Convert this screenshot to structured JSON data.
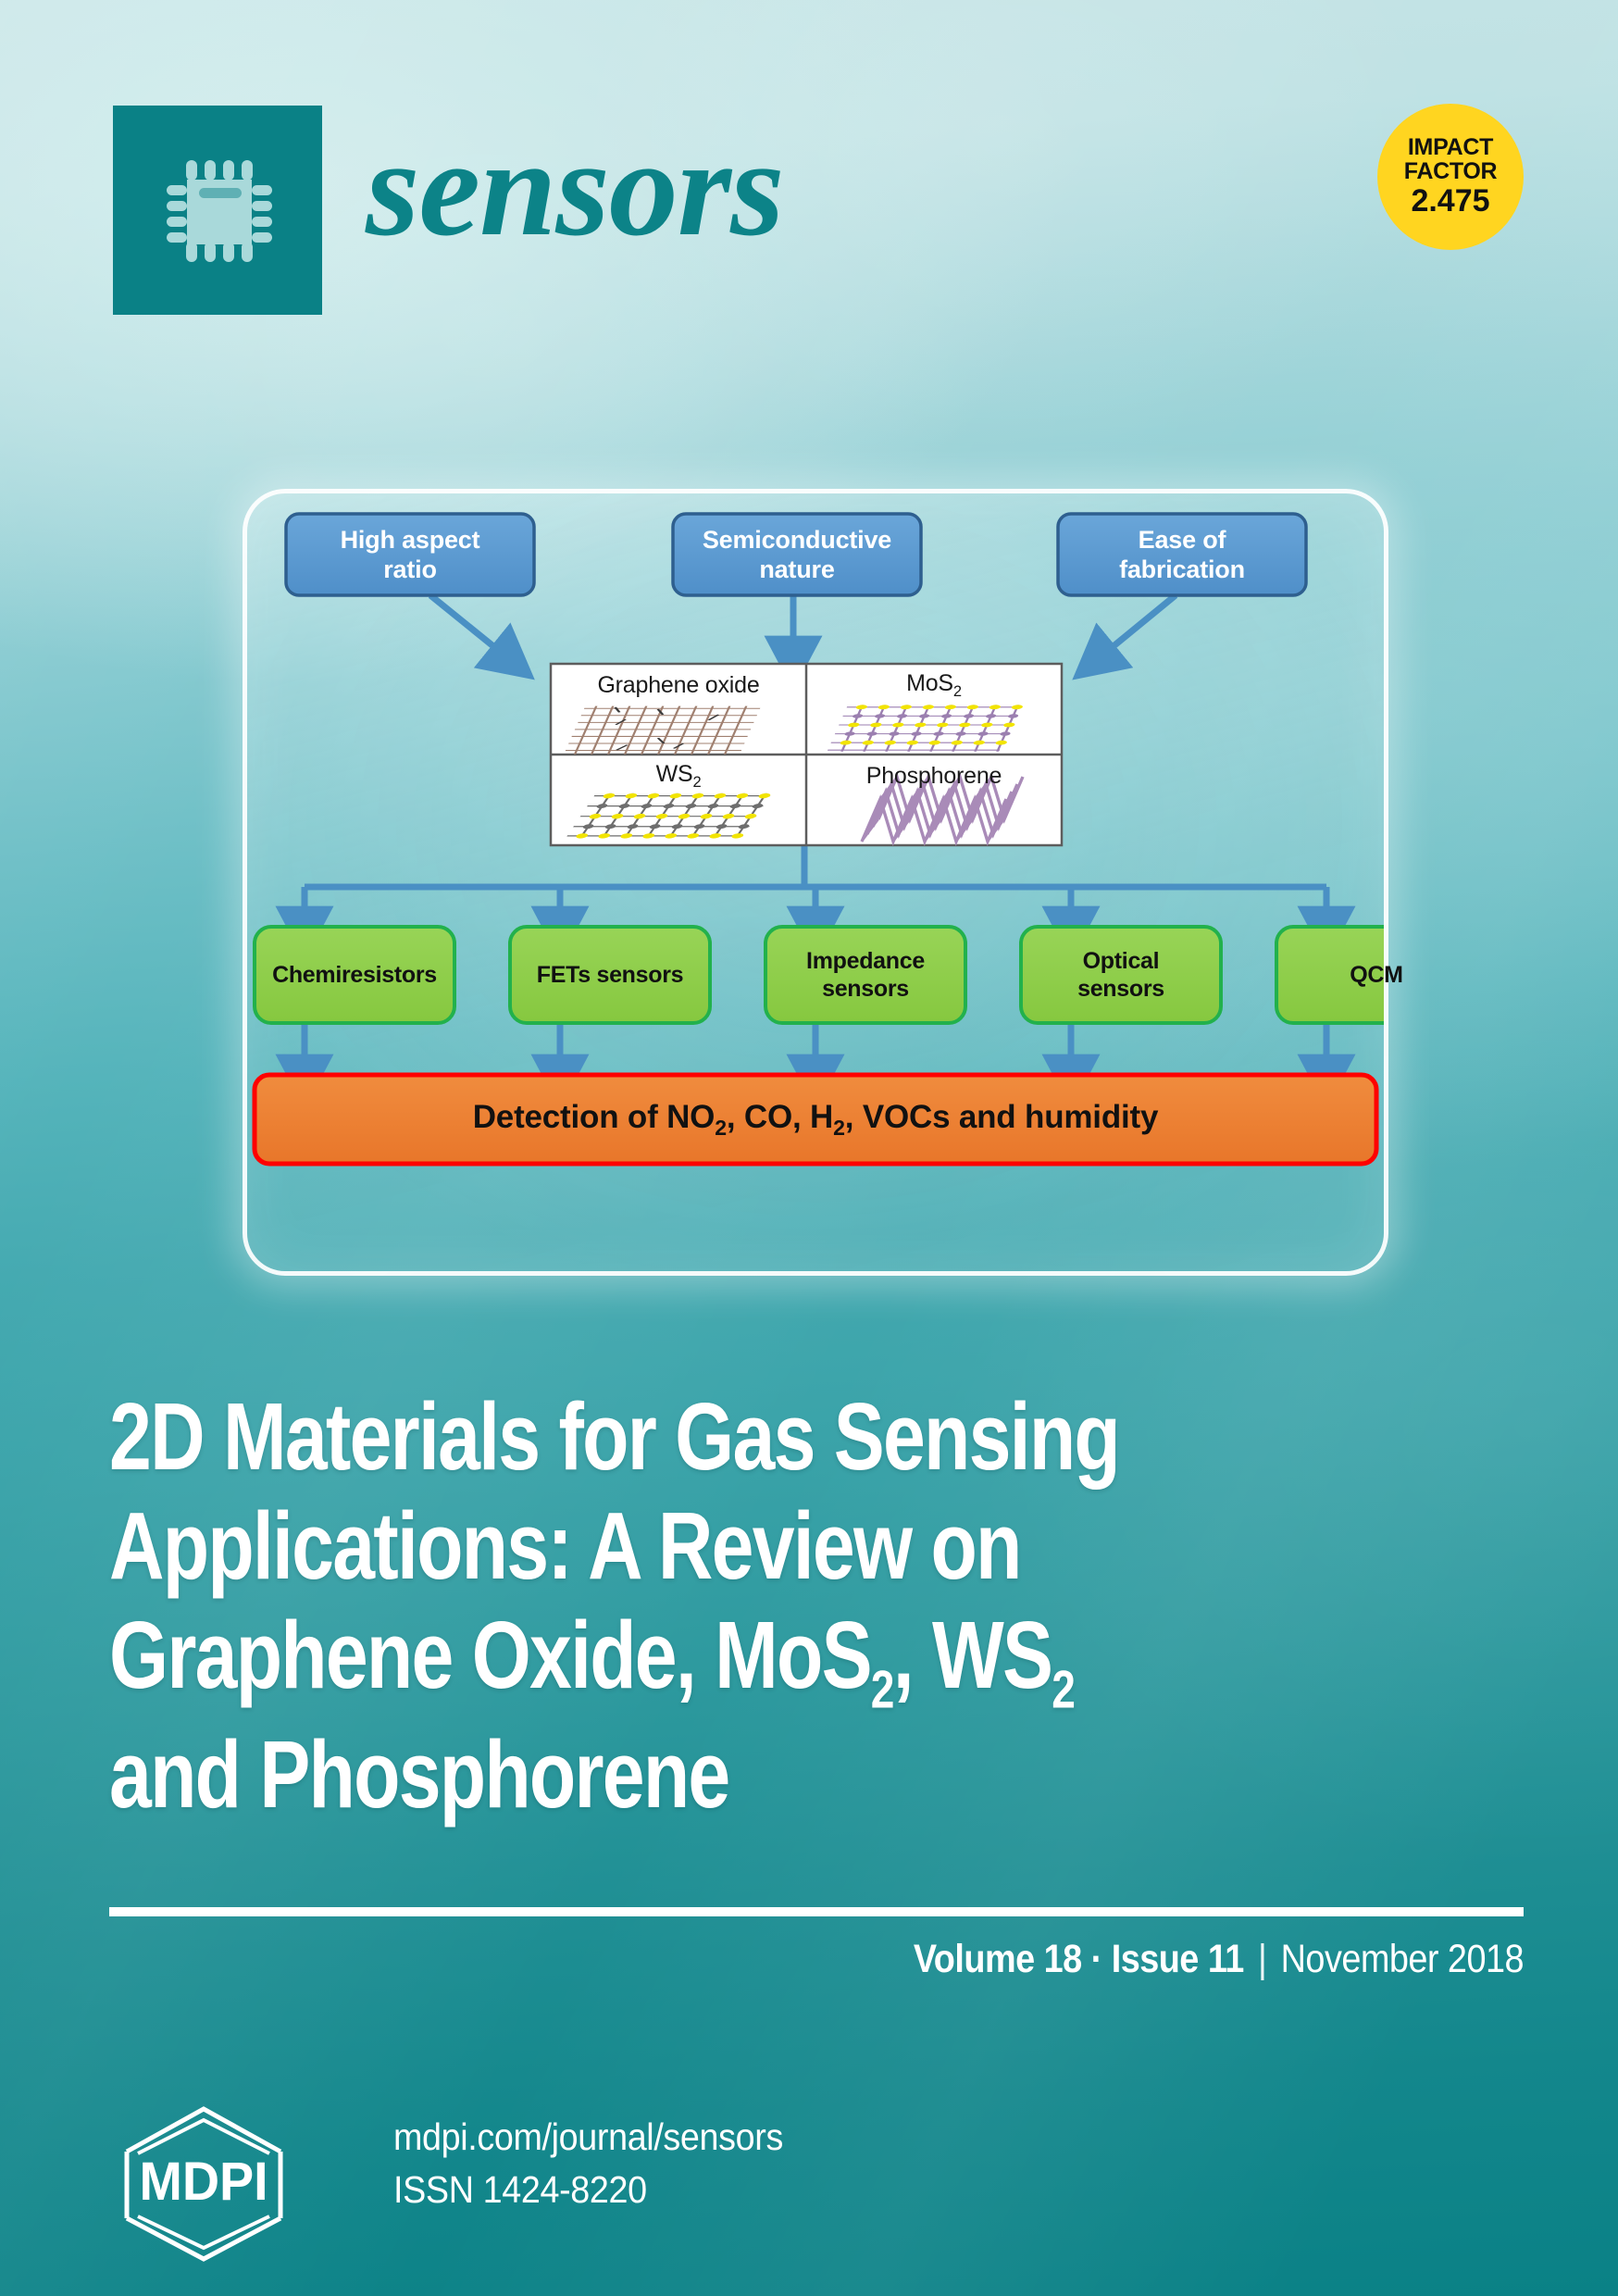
{
  "journal": {
    "name": "sensors",
    "logo_icon": "microchip-icon",
    "brand_color": "#0a8186"
  },
  "impact_factor": {
    "line1": "IMPACT",
    "line2": "FACTOR",
    "value": "2.475",
    "badge_color": "#ffd520"
  },
  "figure": {
    "properties": [
      {
        "label": "High aspect ratio",
        "line1": "High aspect",
        "line2": "ratio"
      },
      {
        "label": "Semiconductive nature",
        "line1": "Semiconductive",
        "line2": "nature"
      },
      {
        "label": "Ease of fabrication",
        "line1": "Ease of",
        "line2": "fabrication"
      }
    ],
    "materials": [
      {
        "name": "Graphene oxide",
        "lattice": "honeycomb-brown"
      },
      {
        "name": "MoS2",
        "name_html": "MoS<sub>2</sub>",
        "lattice": "yellow-purple"
      },
      {
        "name": "WS2",
        "name_html": "WS<sub>2</sub>",
        "lattice": "yellow-gray"
      },
      {
        "name": "Phosphorene",
        "lattice": "purple-corrugated"
      }
    ],
    "sensor_types": [
      {
        "label": "Chemiresistors",
        "line1": "Chemiresistors",
        "line2": ""
      },
      {
        "label": "FETs sensors",
        "line1": "FETs sensors",
        "line2": ""
      },
      {
        "label": "Impedance sensors",
        "line1": "Impedance",
        "line2": "sensors"
      },
      {
        "label": "Optical sensors",
        "line1": "Optical",
        "line2": "sensors"
      },
      {
        "label": "QCM",
        "line1": "QCM",
        "line2": ""
      }
    ],
    "outcome_html": "Detection of NO<sub>2</sub>, CO, H<sub>2</sub>, VOCs and humidity",
    "outcome_text": "Detection of NO2, CO, H2, VOCs and humidity",
    "colors": {
      "property_box_fill": "#5b9bd5",
      "property_box_border": "#2e5f8f",
      "sensor_box_fill": "#92d050",
      "sensor_box_border": "#22b14c",
      "outcome_fill": "#ed7d31",
      "outcome_border": "#ff0000",
      "arrow": "#4a90c4"
    }
  },
  "title_html": "2D Materials for Gas Sensing Applications: A Review on Graphene Oxide, MoS<sub>2</sub>, WS<sub>2</sub> and Phosphorene",
  "title_lines": [
    "2D Materials for Gas Sensing",
    "Applications: A Review on",
    "Graphene Oxide, MoS2, WS2",
    "and Phosphorene"
  ],
  "issue": {
    "volume": "Volume 18",
    "dot": "·",
    "issue": "Issue 11",
    "separator": "|",
    "date": "November 2018"
  },
  "footer": {
    "publisher": "MDPI",
    "url": "mdpi.com/journal/sensors",
    "issn": "ISSN 1424-8220"
  }
}
